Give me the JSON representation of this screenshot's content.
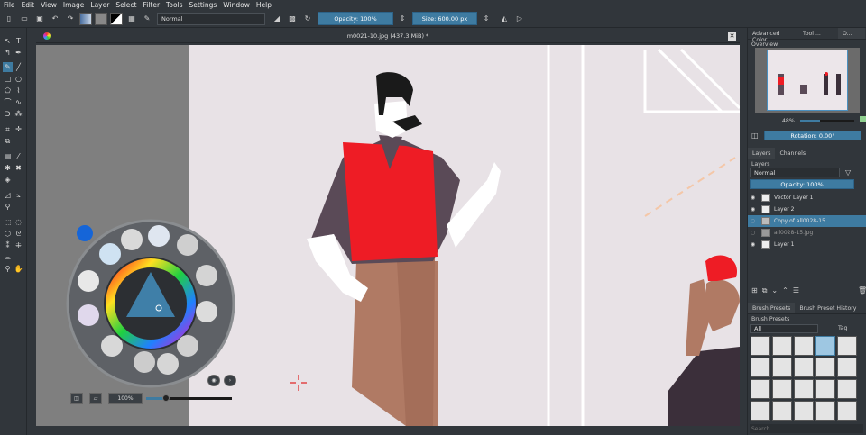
{
  "menu": [
    "File",
    "Edit",
    "View",
    "Image",
    "Layer",
    "Select",
    "Filter",
    "Tools",
    "Settings",
    "Window",
    "Help"
  ],
  "toolbar": {
    "blend_mode": "Normal",
    "opacity_label": "Opacity: 100%",
    "size_label": "Size: 600.00 px"
  },
  "document": {
    "title": "m0021-10.jpg (437.3 MiB) *"
  },
  "popup": {
    "zoom_label": "100%"
  },
  "dock": {
    "top_tabs": [
      "Advanced Color ...",
      "Tool ...",
      "O..."
    ],
    "overview_label": "Overview",
    "overview_zoom": "48%",
    "rotation_label": "Rotation: 0.00°",
    "layer_tabs": [
      "Layers",
      "Channels"
    ],
    "layers_label": "Layers",
    "layers_blend": "Normal",
    "layers_opacity": "Opacity:  100%",
    "layers": [
      {
        "name": "Vector Layer 1",
        "selected": false
      },
      {
        "name": "Layer 2",
        "selected": false
      },
      {
        "name": "Copy of all0028-15....",
        "selected": true
      },
      {
        "name": "all0028-15.jpg",
        "selected": false
      },
      {
        "name": "Layer 1",
        "selected": false
      }
    ],
    "brush_tabs": [
      "Brush Presets",
      "Brush Preset History"
    ],
    "brush_presets_label": "Brush Presets",
    "brush_filter": "All",
    "brush_tag": "Tag",
    "search_placeholder": "Search"
  },
  "colors": {
    "accent": "#3e7ba1",
    "vest": "#ee1c25",
    "shirt": "#5a4a57",
    "pants": "#b07a64",
    "hair": "#1a1a1a",
    "background": "#e8e2e6"
  }
}
